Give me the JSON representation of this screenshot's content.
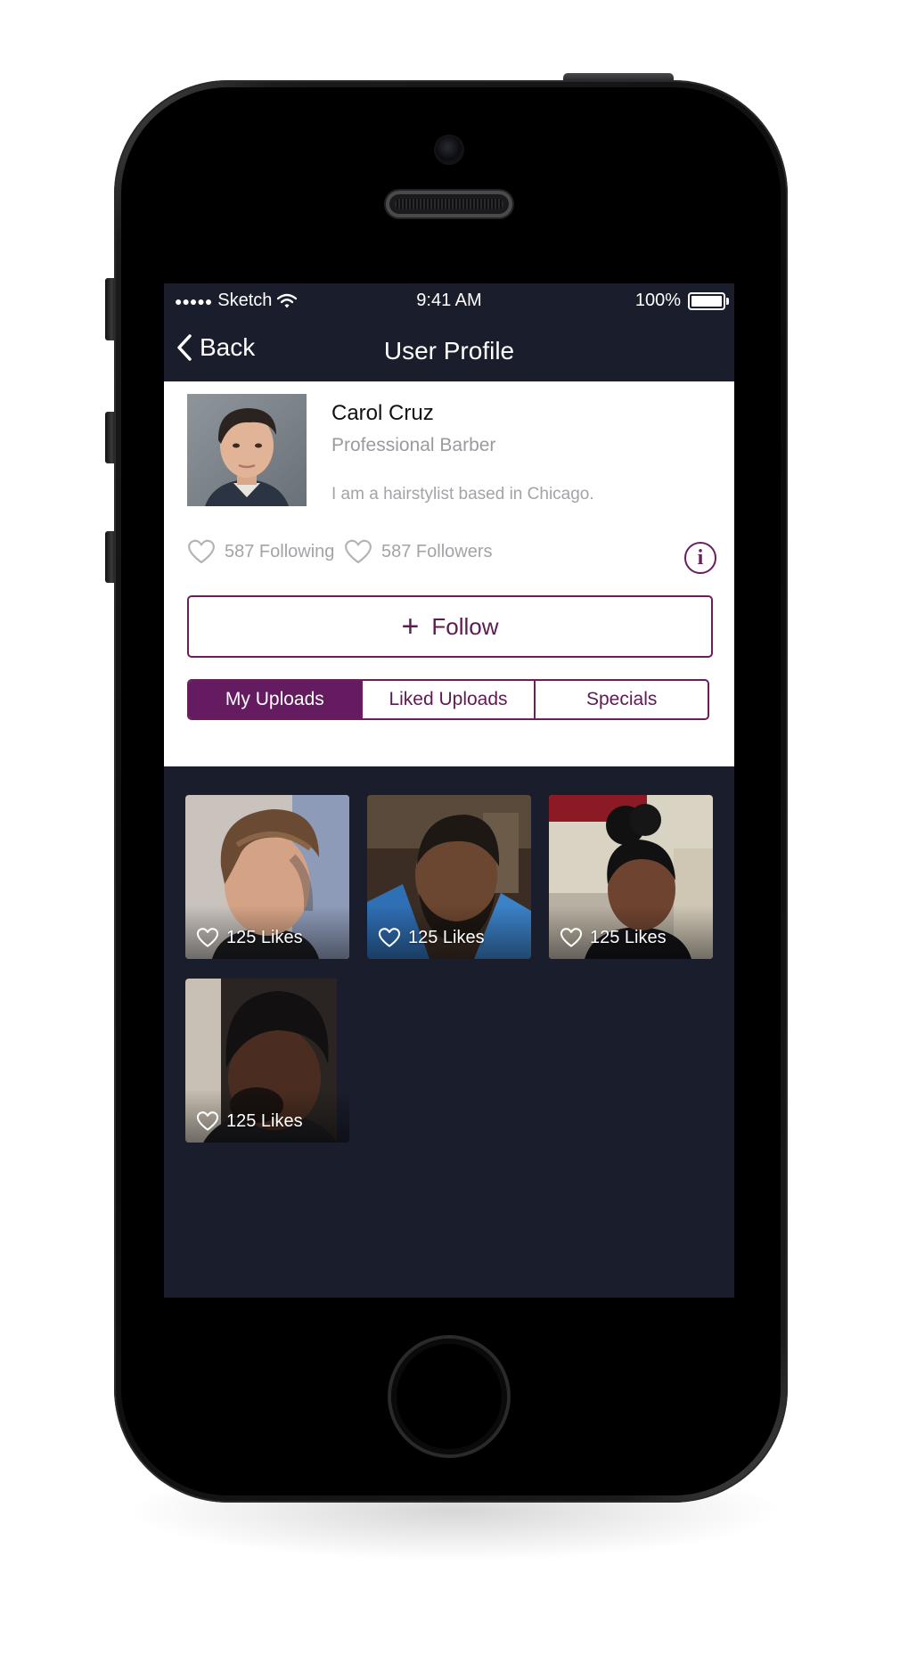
{
  "status_bar": {
    "signal": "●●●●●",
    "carrier": "Sketch",
    "time": "9:41 AM",
    "battery": "100%"
  },
  "nav": {
    "back_label": "Back",
    "title": "User Profile"
  },
  "profile": {
    "name": "Carol Cruz",
    "title": "Professional Barber",
    "bio": "I am a hairstylist based in Chicago.",
    "following": "587 Following",
    "followers": "587 Followers",
    "info_glyph": "i"
  },
  "follow_button": {
    "label": "Follow",
    "icon": "+"
  },
  "tabs": [
    {
      "label": "My Uploads",
      "active": true
    },
    {
      "label": "Liked Uploads",
      "active": false
    },
    {
      "label": "Specials",
      "active": false
    }
  ],
  "uploads": [
    {
      "likes": "125 Likes"
    },
    {
      "likes": "125 Likes"
    },
    {
      "likes": "125 Likes"
    },
    {
      "likes": "125 Likes"
    }
  ],
  "colors": {
    "accent": "#641b60",
    "screen_background": "#1a1d2b",
    "muted_text": "#a3a3a8"
  }
}
